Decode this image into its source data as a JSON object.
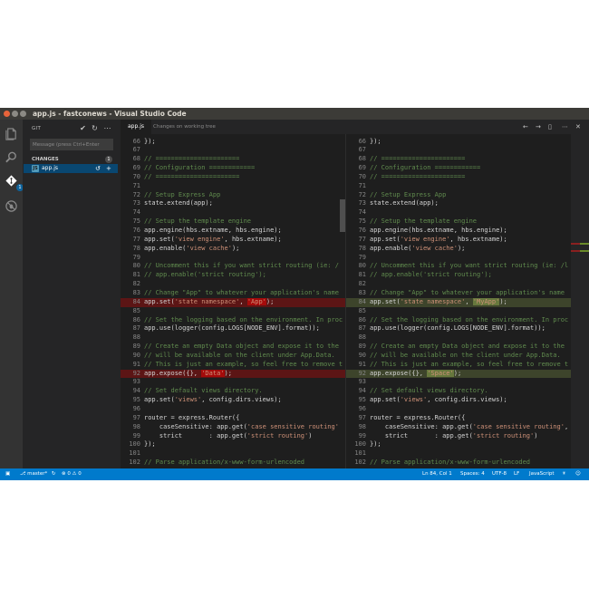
{
  "window": {
    "title": "app.js - fastconews - Visual Studio Code"
  },
  "activity_bar": {
    "items": [
      "files-icon",
      "search-icon",
      "git-icon",
      "debug-icon"
    ],
    "git_badge": "1"
  },
  "sidebar": {
    "header": "GIT",
    "commit_placeholder": "Message (press Ctrl+Enter",
    "changes_label": "CHANGES",
    "changes_count": "1",
    "file": {
      "icon": "JS",
      "name": "app.js"
    }
  },
  "editor": {
    "tab_label": "app.js",
    "tab_description": "Changes on working tree",
    "left": [
      {
        "n": "66",
        "t": [
          [
            "});",
            ""
          ]
        ]
      },
      {
        "n": "67",
        "t": []
      },
      {
        "n": "68",
        "t": [
          [
            "// ======================",
            "com"
          ]
        ]
      },
      {
        "n": "69",
        "t": [
          [
            "// Configuration ============",
            "com"
          ]
        ]
      },
      {
        "n": "70",
        "t": [
          [
            "// ======================",
            "com"
          ]
        ]
      },
      {
        "n": "71",
        "t": []
      },
      {
        "n": "72",
        "t": [
          [
            "// Setup Express App",
            "com"
          ]
        ]
      },
      {
        "n": "73",
        "t": [
          [
            "state.extend(app);",
            ""
          ]
        ]
      },
      {
        "n": "74",
        "t": []
      },
      {
        "n": "75",
        "t": [
          [
            "// Setup the template engine",
            "com"
          ]
        ]
      },
      {
        "n": "76",
        "t": [
          [
            "app.engine(hbs.extname, hbs.engine);",
            ""
          ]
        ]
      },
      {
        "n": "77",
        "t": [
          [
            "app.set(",
            ""
          ],
          [
            "'view engine'",
            "str"
          ],
          [
            ", hbs.extname);",
            ""
          ]
        ]
      },
      {
        "n": "78",
        "t": [
          [
            "app.enable(",
            ""
          ],
          [
            "'view cache'",
            "str"
          ],
          [
            ");",
            ""
          ]
        ]
      },
      {
        "n": "79",
        "t": []
      },
      {
        "n": "80",
        "t": [
          [
            "// Uncomment this if you want strict routing (ie: /",
            "com"
          ]
        ]
      },
      {
        "n": "81",
        "t": [
          [
            "// app.enable('strict routing');",
            "com"
          ]
        ]
      },
      {
        "n": "82",
        "t": []
      },
      {
        "n": "83",
        "t": [
          [
            "// Change \"App\" to whatever your application's name",
            "com"
          ]
        ]
      },
      {
        "n": "84",
        "d": "removed",
        "t": [
          [
            "app.set(",
            ""
          ],
          [
            "'state namespace'",
            "str"
          ],
          [
            ", ",
            ""
          ],
          [
            "'App'",
            "str hl-rem"
          ],
          [
            ");",
            ""
          ]
        ]
      },
      {
        "n": "85",
        "t": []
      },
      {
        "n": "86",
        "t": [
          [
            "// Set the logging based on the environment. In proc",
            "com"
          ]
        ]
      },
      {
        "n": "87",
        "t": [
          [
            "app.use(logger(config.LOGS[NODE_ENV].format));",
            ""
          ]
        ]
      },
      {
        "n": "88",
        "t": []
      },
      {
        "n": "89",
        "t": [
          [
            "// Create an empty Data object and expose it to the",
            "com"
          ]
        ]
      },
      {
        "n": "90",
        "t": [
          [
            "// will be available on the client under App.Data.",
            "com"
          ]
        ]
      },
      {
        "n": "91",
        "t": [
          [
            "// This is just an example, so feel free to remove t",
            "com"
          ]
        ]
      },
      {
        "n": "92",
        "d": "removed",
        "t": [
          [
            "app.expose({}, ",
            ""
          ],
          [
            "'Data'",
            "str hl-rem"
          ],
          [
            ");",
            ""
          ]
        ]
      },
      {
        "n": "93",
        "t": []
      },
      {
        "n": "94",
        "t": [
          [
            "// Set default views directory.",
            "com"
          ]
        ]
      },
      {
        "n": "95",
        "t": [
          [
            "app.set(",
            ""
          ],
          [
            "'views'",
            "str"
          ],
          [
            ", config.dirs.views);",
            ""
          ]
        ]
      },
      {
        "n": "96",
        "t": []
      },
      {
        "n": "97",
        "t": [
          [
            "router = express.Router({",
            ""
          ]
        ]
      },
      {
        "n": "98",
        "t": [
          [
            "    caseSensitive: app.get(",
            ""
          ],
          [
            "'case sensitive routing'",
            "str"
          ]
        ]
      },
      {
        "n": "99",
        "t": [
          [
            "    strict       : app.get(",
            ""
          ],
          [
            "'strict routing'",
            "str"
          ],
          [
            ")",
            ""
          ]
        ]
      },
      {
        "n": "100",
        "t": [
          [
            "});",
            ""
          ]
        ]
      },
      {
        "n": "101",
        "t": []
      },
      {
        "n": "102",
        "t": [
          [
            "// Parse application/x-www-form-urlencoded",
            "com"
          ]
        ]
      }
    ],
    "right": [
      {
        "n": "66",
        "t": [
          [
            "});",
            ""
          ]
        ]
      },
      {
        "n": "67",
        "t": []
      },
      {
        "n": "68",
        "t": [
          [
            "// ======================",
            "com"
          ]
        ]
      },
      {
        "n": "69",
        "t": [
          [
            "// Configuration ============",
            "com"
          ]
        ]
      },
      {
        "n": "70",
        "t": [
          [
            "// ======================",
            "com"
          ]
        ]
      },
      {
        "n": "71",
        "t": []
      },
      {
        "n": "72",
        "t": [
          [
            "// Setup Express App",
            "com"
          ]
        ]
      },
      {
        "n": "73",
        "t": [
          [
            "state.extend(app);",
            ""
          ]
        ]
      },
      {
        "n": "74",
        "t": []
      },
      {
        "n": "75",
        "t": [
          [
            "// Setup the template engine",
            "com"
          ]
        ]
      },
      {
        "n": "76",
        "t": [
          [
            "app.engine(hbs.extname, hbs.engine);",
            ""
          ]
        ]
      },
      {
        "n": "77",
        "t": [
          [
            "app.set(",
            ""
          ],
          [
            "'view engine'",
            "str"
          ],
          [
            ", hbs.extname);",
            ""
          ]
        ]
      },
      {
        "n": "78",
        "t": [
          [
            "app.enable(",
            ""
          ],
          [
            "'view cache'",
            "str"
          ],
          [
            ");",
            ""
          ]
        ]
      },
      {
        "n": "79",
        "t": []
      },
      {
        "n": "80",
        "t": [
          [
            "// Uncomment this if you want strict routing (ie: /l",
            "com"
          ]
        ]
      },
      {
        "n": "81",
        "t": [
          [
            "// app.enable('strict routing');",
            "com"
          ]
        ]
      },
      {
        "n": "82",
        "t": []
      },
      {
        "n": "83",
        "t": [
          [
            "// Change \"App\" to whatever your application's name",
            "com"
          ]
        ]
      },
      {
        "n": "84",
        "d": "added",
        "t": [
          [
            "app.set(",
            ""
          ],
          [
            "'state namespace'",
            "str"
          ],
          [
            ", ",
            ""
          ],
          [
            "'MyApp'",
            "str hl-add"
          ],
          [
            ");",
            ""
          ]
        ]
      },
      {
        "n": "85",
        "t": []
      },
      {
        "n": "86",
        "t": [
          [
            "// Set the logging based on the environment. In proc",
            "com"
          ]
        ]
      },
      {
        "n": "87",
        "t": [
          [
            "app.use(logger(config.LOGS[NODE_ENV].format));",
            ""
          ]
        ]
      },
      {
        "n": "88",
        "t": []
      },
      {
        "n": "89",
        "t": [
          [
            "// Create an empty Data object and expose it to the",
            "com"
          ]
        ]
      },
      {
        "n": "90",
        "t": [
          [
            "// will be available on the client under App.Data.",
            "com"
          ]
        ]
      },
      {
        "n": "91",
        "t": [
          [
            "// This is just an example, so feel free to remove t",
            "com"
          ]
        ]
      },
      {
        "n": "92",
        "d": "added",
        "t": [
          [
            "app.expose({}, ",
            ""
          ],
          [
            "'Space'",
            "str hl-add"
          ],
          [
            ");",
            ""
          ]
        ]
      },
      {
        "n": "93",
        "t": []
      },
      {
        "n": "94",
        "t": [
          [
            "// Set default views directory.",
            "com"
          ]
        ]
      },
      {
        "n": "95",
        "t": [
          [
            "app.set(",
            ""
          ],
          [
            "'views'",
            "str"
          ],
          [
            ", config.dirs.views);",
            ""
          ]
        ]
      },
      {
        "n": "96",
        "t": []
      },
      {
        "n": "97",
        "t": [
          [
            "router = express.Router({",
            ""
          ]
        ]
      },
      {
        "n": "98",
        "t": [
          [
            "    caseSensitive: app.get(",
            ""
          ],
          [
            "'case sensitive routing'",
            "str"
          ],
          [
            ",",
            ""
          ]
        ]
      },
      {
        "n": "99",
        "t": [
          [
            "    strict       : app.get(",
            ""
          ],
          [
            "'strict routing'",
            "str"
          ],
          [
            ")",
            ""
          ]
        ]
      },
      {
        "n": "100",
        "t": [
          [
            "});",
            ""
          ]
        ]
      },
      {
        "n": "101",
        "t": []
      },
      {
        "n": "102",
        "t": [
          [
            "// Parse application/x-www-form-urlencoded",
            "com"
          ]
        ]
      }
    ]
  },
  "status_bar": {
    "branch": "master*",
    "errors": "0",
    "warnings": "0",
    "position": "Ln 84, Col 1",
    "spaces": "Spaces: 4",
    "encoding": "UTF-8",
    "eol": "LF",
    "language": "JavaScript"
  },
  "colors": {
    "statusbar": "#007acc",
    "removed": "#5a1d1d",
    "added": "#3b4a26",
    "string": "#ce9178",
    "comment": "#608b4e"
  }
}
